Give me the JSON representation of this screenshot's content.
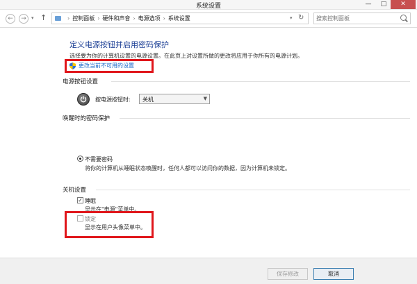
{
  "window": {
    "title": "系统设置",
    "controls": {
      "minimize": "—",
      "maximize": "□",
      "close": "✕"
    }
  },
  "address_bar": {
    "crumbs": [
      "控制面板",
      "硬件和声音",
      "电源选项",
      "系统设置"
    ],
    "search_placeholder": "搜索控制面板"
  },
  "page": {
    "heading": "定义电源按钮并启用密码保护",
    "description": "选择要为你的计算机设置的电源设置。在此页上对设置所做的更改将应用于你所有的电源计划。",
    "change_link": "更改当前不可用的设置"
  },
  "power_button": {
    "section_title": "电源按钮设置",
    "label": "按电源按钮时:",
    "selected": "关机"
  },
  "wake_password": {
    "section_title": "唤醒时的密码保护",
    "option_label": "不需要密码",
    "option_desc": "将你的计算机从睡眠状态唤醒时，任何人都可以访问你的数据，因为计算机未锁定。"
  },
  "shutdown": {
    "section_title": "关机设置",
    "items": [
      {
        "label": "睡眠",
        "desc": "显示在\"电源\"菜单中。",
        "checked": true
      },
      {
        "label": "锁定",
        "desc": "显示在用户头像菜单中。",
        "checked": false
      }
    ]
  },
  "footer": {
    "save_label": "保存修改",
    "cancel_label": "取消"
  },
  "colors": {
    "heading": "#1c3f95",
    "link": "#1666c9",
    "highlight": "#e0161b"
  }
}
